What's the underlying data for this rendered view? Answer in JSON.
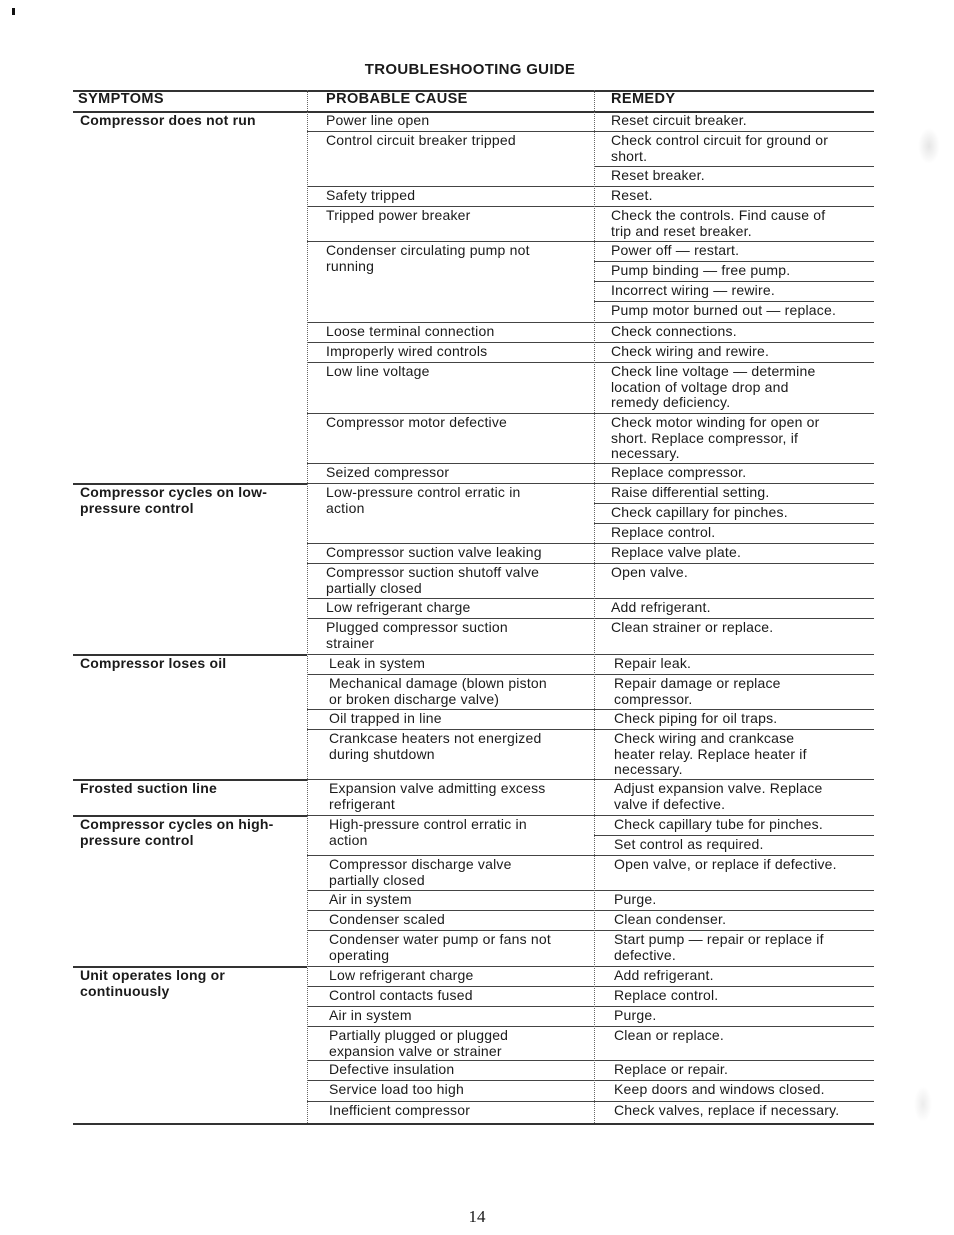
{
  "page": {
    "title": "TROUBLESHOOTING GUIDE",
    "page_number": "14"
  },
  "table": {
    "headers": [
      "SYMPTOMS",
      "PROBABLE CAUSE",
      "REMEDY"
    ],
    "symptoms": [
      "Compressor does not run",
      "Compressor cycles on low-\npressure control",
      "Compressor loses oil",
      "Frosted suction line",
      "Compressor cycles on high-\npressure control",
      "Unit operates long or\ncontinuously"
    ],
    "causes": [
      "Power line open",
      "Control circuit breaker tripped",
      "Safety tripped",
      "Tripped power breaker",
      "Condenser circulating pump not\nrunning",
      "Loose terminal connection",
      "Improperly wired controls",
      "Low line voltage",
      "Compressor motor defective",
      "Seized compressor",
      "Low-pressure control erratic in\naction",
      "Compressor suction valve leaking",
      "Compressor suction shutoff valve\npartially closed",
      "Low refrigerant charge",
      "Plugged compressor suction\nstrainer",
      "Leak in system",
      "Mechanical damage (blown piston\nor broken discharge valve)",
      "Oil trapped in line",
      "Crankcase heaters not energized\nduring shutdown",
      "Expansion valve admitting excess\nrefrigerant",
      "High-pressure control erratic in\naction",
      "Compressor discharge valve\npartially closed",
      "Air in system",
      "Condenser scaled",
      "Condenser water pump or fans not\noperating",
      "Low refrigerant charge",
      "Control contacts fused",
      "Air in system",
      "Partially plugged or plugged\nexpansion valve or strainer",
      "Defective insulation",
      "Service load too high",
      "Inefficient compressor"
    ],
    "remedies": [
      "Reset circuit breaker.",
      "Check control circuit for ground or\nshort.",
      "Reset breaker.",
      "Reset.",
      "Check the controls. Find cause of\ntrip and reset breaker.",
      "Power off — restart.",
      "Pump binding — free pump.",
      "Incorrect wiring — rewire.",
      "Pump motor burned out — replace.",
      "Check connections.",
      "Check wiring and rewire.",
      "Check line voltage — determine\nlocation of voltage drop and\nremedy deficiency.",
      "Check motor winding for open or\nshort. Replace compressor, if\nnecessary.",
      "Replace compressor.",
      "Raise differential setting.",
      "Check capillary for pinches.",
      "Replace control.",
      "Replace valve plate.",
      "Open valve.",
      "Add refrigerant.",
      "Clean strainer or replace.",
      "Repair leak.",
      "Repair damage or replace\ncompressor.",
      "Check piping for oil traps.",
      "Check wiring and crankcase\nheater relay. Replace heater if\nnecessary.",
      "Adjust expansion valve. Replace\nvalve if defective.",
      "Check capillary tube for pinches.",
      "Set control as required.",
      "Open valve, or replace if defective.",
      "Purge.",
      "Clean condenser.",
      "Start pump — repair or replace if\ndefective.",
      "Add refrigerant.",
      "Replace control.",
      "Purge.",
      "Clean or replace.",
      "Replace or repair.",
      "Keep doors and windows closed.",
      "Check valves, replace if necessary."
    ]
  }
}
